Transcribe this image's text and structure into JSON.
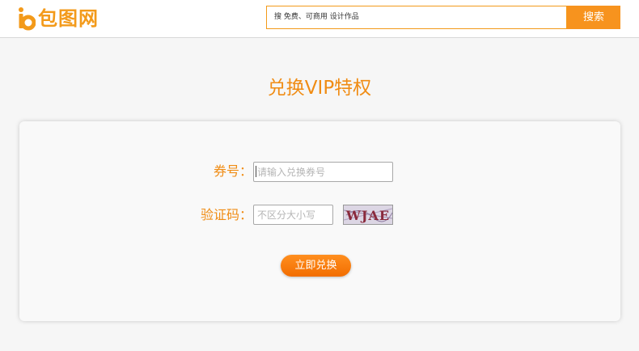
{
  "header": {
    "logo_text": "包图网",
    "search_placeholder": "搜 免费、可商用 设计作品",
    "search_button": "搜索"
  },
  "main": {
    "title": "兑换VIP特权",
    "form": {
      "coupon_label": "券号：",
      "coupon_placeholder": "请输入兑换券号",
      "captcha_label": "验证码：",
      "captcha_placeholder": "不区分大小写",
      "captcha_text": "WJAE",
      "submit_label": "立即兑换"
    }
  },
  "colors": {
    "accent": "#f39a1a",
    "label": "#f08c14",
    "button_top": "#ff8f1f",
    "button_bottom": "#f26d00"
  }
}
